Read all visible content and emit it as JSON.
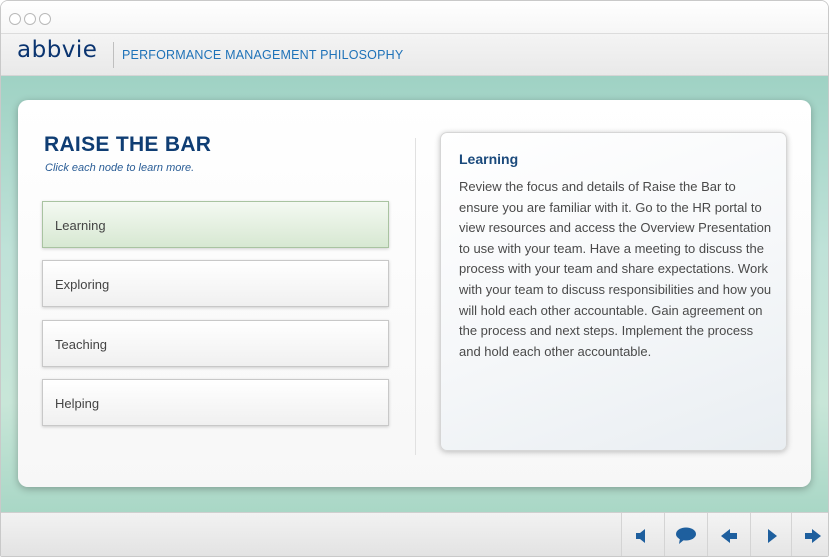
{
  "window": {
    "controls": [
      "close",
      "minimize",
      "zoom"
    ]
  },
  "header": {
    "logo": "abbvie",
    "title": "PERFORMANCE MANAGEMENT PHILOSOPHY"
  },
  "main": {
    "title": "RAISE THE BAR",
    "subtitle": "Click each node to learn more.",
    "nodes": [
      {
        "label": "Learning",
        "selected": true
      },
      {
        "label": "Exploring",
        "selected": false
      },
      {
        "label": "Teaching",
        "selected": false
      },
      {
        "label": "Helping",
        "selected": false
      }
    ],
    "info": {
      "title": "Learning",
      "body": "Review the focus and details of Raise the Bar to ensure you are familiar with it. Go to the HR portal to view resources and access the Overview Presentation to use with your team. Have a meeting to discuss the process with your team and share expectations. Work with your team to discuss responsibilities and how you will hold each other accountable. Gain agreement on the process and next steps. Implement the process and hold each other accountable."
    }
  },
  "footer": {
    "controls": [
      {
        "icon": "speaker-icon"
      },
      {
        "icon": "speech-bubble-icon"
      },
      {
        "icon": "arrow-left-icon"
      },
      {
        "icon": "play-icon"
      },
      {
        "icon": "arrow-right-icon"
      }
    ]
  },
  "colors": {
    "brand_navy": "#0a3470",
    "header_blue": "#1e72b8",
    "title_navy": "#0f3d73",
    "icon_blue": "#1e5f9e",
    "stage_teal": "#a9d7c6"
  }
}
